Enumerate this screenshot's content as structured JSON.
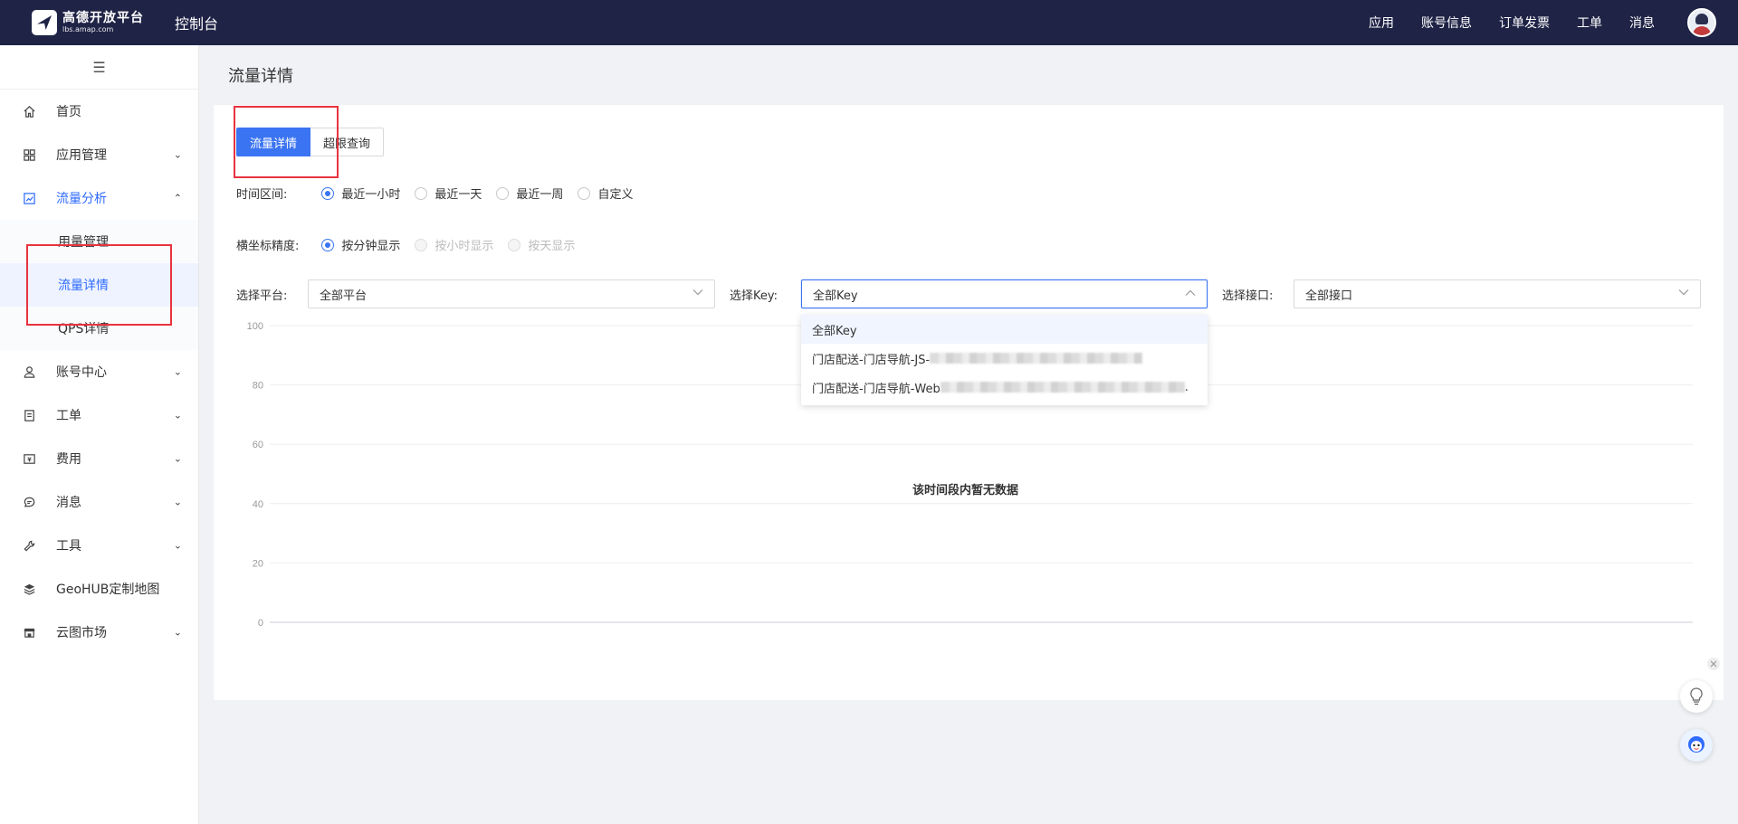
{
  "topnav": {
    "logo_title": "高德开放平台",
    "logo_sub": "lbs.amap.com",
    "console": "控制台",
    "links": [
      "应用",
      "账号信息",
      "订单发票",
      "工单",
      "消息"
    ]
  },
  "sidebar": {
    "collapse_icon": "menu-icon",
    "items": [
      {
        "label": "首页",
        "icon": "home-icon"
      },
      {
        "label": "应用管理",
        "icon": "apps-icon"
      },
      {
        "label": "流量分析",
        "icon": "chart-icon"
      },
      {
        "label": "账号中心",
        "icon": "user-icon"
      },
      {
        "label": "工单",
        "icon": "ticket-icon"
      },
      {
        "label": "费用",
        "icon": "fee-icon"
      },
      {
        "label": "消息",
        "icon": "message-icon"
      },
      {
        "label": "工具",
        "icon": "wrench-icon"
      },
      {
        "label": "GeoHUB定制地图",
        "icon": "layers-icon"
      },
      {
        "label": "云图市场",
        "icon": "store-icon"
      }
    ],
    "sub_items": [
      "用量管理",
      "流量详情",
      "QPS详情"
    ]
  },
  "page": {
    "title": "流量详情",
    "tabs": [
      "流量详情",
      "超限查询"
    ],
    "time_range": {
      "label": "时间区间:",
      "options": [
        "最近一小时",
        "最近一天",
        "最近一周",
        "自定义"
      ],
      "selected": "最近一小时"
    },
    "precision": {
      "label": "横坐标精度:",
      "options": [
        "按分钟显示",
        "按小时显示",
        "按天显示"
      ],
      "selected": "按分钟显示"
    },
    "filters": {
      "platform_label": "选择平台:",
      "platform_value": "全部平台",
      "key_label": "选择Key:",
      "key_value": "全部Key",
      "api_label": "选择接口:",
      "api_value": "全部接口"
    },
    "key_dropdown": [
      "全部Key",
      "门店配送-门店导航-JS-",
      "门店配送-门店导航-Web"
    ],
    "no_data": "该时间段内暂无数据"
  },
  "chart_data": {
    "type": "line",
    "title": "",
    "xlabel": "",
    "ylabel": "",
    "ylim": [
      0,
      100
    ],
    "yticks": [
      0,
      20,
      40,
      60,
      80,
      100
    ],
    "grid": true,
    "series": []
  },
  "colors": {
    "nav_bg": "#1f2346",
    "accent": "#3b74f2",
    "highlight": "#e8333f"
  }
}
